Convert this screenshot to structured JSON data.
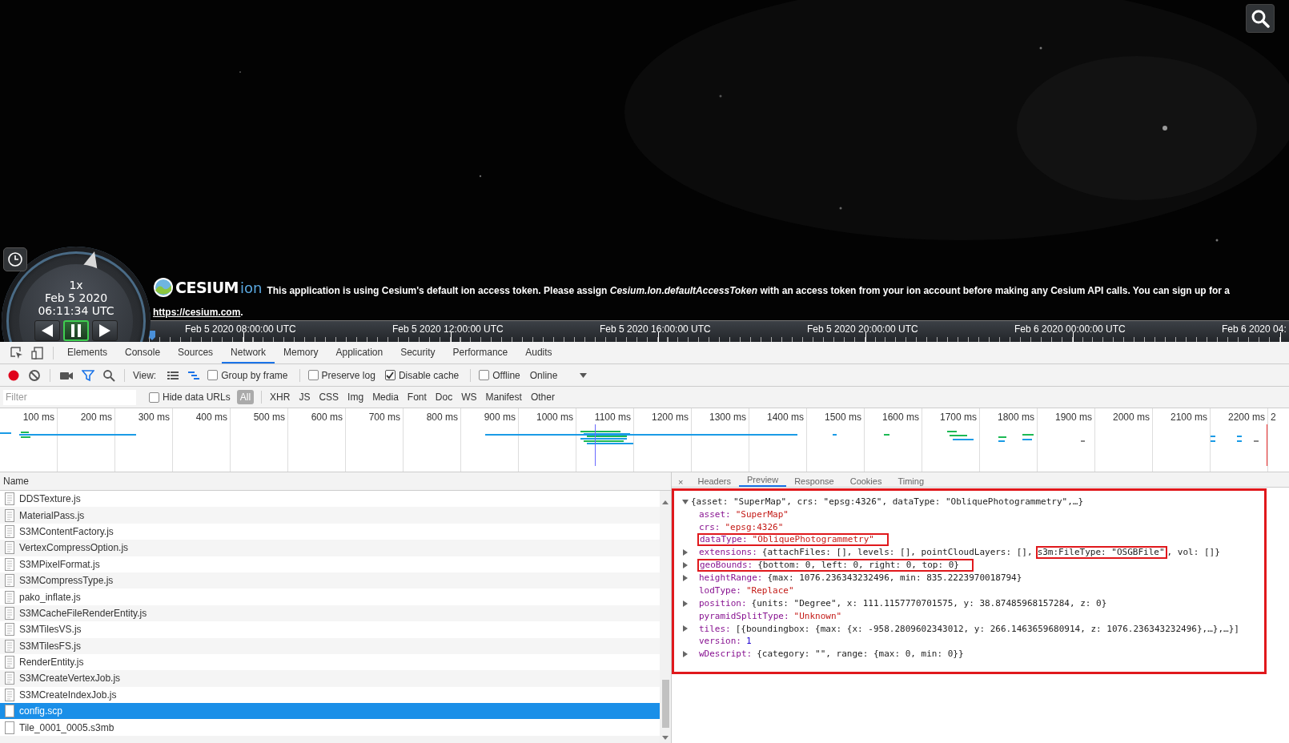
{
  "viewer": {
    "clock": {
      "speed": "1x",
      "date": "Feb 5 2020",
      "time": "06:11:34 UTC",
      "controls": [
        {
          "kind": "reverse",
          "selected": false
        },
        {
          "kind": "pause",
          "selected": true
        },
        {
          "kind": "play",
          "selected": false
        }
      ]
    },
    "banner": {
      "logo_word": "CESIUM",
      "logo_suffix": "ion",
      "message": "This application is using Cesium's default ion access token. Please assign *Cesium.Ion.defaultAccessToken* with an access token from your ion account before making any Cesium API calls. You can sign up for a",
      "link": "https://cesium.com",
      "link_suffix": "."
    },
    "timeline": {
      "labels": [
        "Feb 5 2020 08:00:00 UTC",
        "Feb 5 2020 12:00:00 UTC",
        "Feb 5 2020 16:00:00 UTC",
        "Feb 5 2020 20:00:00 UTC",
        "Feb 6 2020 00:00:00 UTC",
        "Feb 6 2020 04:"
      ]
    }
  },
  "devtools": {
    "panels": [
      {
        "label": "Elements",
        "selected": false
      },
      {
        "label": "Console",
        "selected": false
      },
      {
        "label": "Sources",
        "selected": false
      },
      {
        "label": "Network",
        "selected": true
      },
      {
        "label": "Memory",
        "selected": false
      },
      {
        "label": "Application",
        "selected": false
      },
      {
        "label": "Security",
        "selected": false
      },
      {
        "label": "Performance",
        "selected": false
      },
      {
        "label": "Audits",
        "selected": false
      }
    ],
    "toolbar": {
      "recording": true,
      "filter_active": true,
      "view_label": "View:",
      "views": [
        {
          "kind": "list",
          "selected": false
        },
        {
          "kind": "waterfall",
          "selected": true
        }
      ],
      "options": [
        {
          "label": "Group by frame",
          "checked": false
        },
        {
          "label": "Preserve log",
          "checked": false
        },
        {
          "label": "Disable cache",
          "checked": true
        },
        {
          "label": "Offline",
          "checked": false
        }
      ],
      "throttle": "Online"
    },
    "filter": {
      "placeholder": "Filter",
      "hide_data_urls": {
        "label": "Hide data URLs",
        "checked": false
      },
      "types": [
        {
          "label": "All",
          "selected": true
        },
        {
          "label": "XHR",
          "selected": false
        },
        {
          "label": "JS",
          "selected": false
        },
        {
          "label": "CSS",
          "selected": false
        },
        {
          "label": "Img",
          "selected": false
        },
        {
          "label": "Media",
          "selected": false
        },
        {
          "label": "Font",
          "selected": false
        },
        {
          "label": "Doc",
          "selected": false
        },
        {
          "label": "WS",
          "selected": false
        },
        {
          "label": "Manifest",
          "selected": false
        },
        {
          "label": "Other",
          "selected": false
        }
      ]
    },
    "overview": {
      "ticks": [
        "100 ms",
        "200 ms",
        "300 ms",
        "400 ms",
        "500 ms",
        "600 ms",
        "700 ms",
        "800 ms",
        "900 ms",
        "1000 ms",
        "1100 ms",
        "1200 ms",
        "1300 ms",
        "1400 ms",
        "1500 ms",
        "1600 ms",
        "1700 ms",
        "1800 ms",
        "1900 ms",
        "2000 ms",
        "2100 ms",
        "2200 ms",
        "2"
      ]
    },
    "requests": {
      "column": "Name",
      "rows": [
        {
          "name": "DDSTexture.js",
          "kind": "script",
          "selected": false
        },
        {
          "name": "MaterialPass.js",
          "kind": "script",
          "selected": false
        },
        {
          "name": "S3MContentFactory.js",
          "kind": "script",
          "selected": false
        },
        {
          "name": "VertexCompressOption.js",
          "kind": "script",
          "selected": false
        },
        {
          "name": "S3MPixelFormat.js",
          "kind": "script",
          "selected": false
        },
        {
          "name": "S3MCompressType.js",
          "kind": "script",
          "selected": false
        },
        {
          "name": "pako_inflate.js",
          "kind": "script",
          "selected": false
        },
        {
          "name": "S3MCacheFileRenderEntity.js",
          "kind": "script",
          "selected": false
        },
        {
          "name": "S3MTilesVS.js",
          "kind": "script",
          "selected": false
        },
        {
          "name": "S3MTilesFS.js",
          "kind": "script",
          "selected": false
        },
        {
          "name": "RenderEntity.js",
          "kind": "script",
          "selected": false
        },
        {
          "name": "S3MCreateVertexJob.js",
          "kind": "script",
          "selected": false
        },
        {
          "name": "S3MCreateIndexJob.js",
          "kind": "script",
          "selected": false
        },
        {
          "name": "config.scp",
          "kind": "document",
          "selected": true
        },
        {
          "name": "Tile_0001_0005.s3mb",
          "kind": "document",
          "selected": false
        }
      ]
    },
    "details": {
      "close": "×",
      "tabs": [
        {
          "label": "Headers",
          "selected": false
        },
        {
          "label": "Preview",
          "selected": true
        },
        {
          "label": "Response",
          "selected": false
        },
        {
          "label": "Cookies",
          "selected": false
        },
        {
          "label": "Timing",
          "selected": false
        }
      ],
      "preview": {
        "framed": true,
        "expanded": true,
        "summary": "{asset: \"SuperMap\", crs: \"epsg:4326\", dataType: \"ObliquePhotogrammetry\",…}",
        "properties": [
          {
            "key": "asset:",
            "value": "\"SuperMap\"",
            "kind": "string",
            "expandable": false,
            "highlighted": false
          },
          {
            "key": "crs:",
            "value": "\"epsg:4326\"",
            "kind": "string",
            "expandable": false,
            "highlighted": false
          },
          {
            "key": "dataType:",
            "value": "\"ObliquePhotogrammetry\"",
            "kind": "string",
            "expandable": false,
            "highlighted": true
          },
          {
            "key": "extensions:",
            "value": "{attachFiles: [], levels: [], pointCloudLayers: [],",
            "highlight": "s3m:FileType: \"OSGBFile\"",
            "value_end": ", vol: []}",
            "kind": "object",
            "expandable": true,
            "highlighted": false
          },
          {
            "key": "geoBounds:",
            "value": "{bottom: 0, left: 0, right: 0, top: 0}",
            "kind": "object",
            "expandable": true,
            "highlighted": true
          },
          {
            "key": "heightRange:",
            "value": "{max: 1076.236343232496, min: 835.2223970018794}",
            "kind": "object",
            "expandable": true,
            "highlighted": false
          },
          {
            "key": "lodType:",
            "value": "\"Replace\"",
            "kind": "string",
            "expandable": false,
            "highlighted": false
          },
          {
            "key": "position:",
            "value": "{units: \"Degree\", x: 111.1157770701575, y: 38.87485968157284, z: 0}",
            "kind": "object",
            "expandable": true,
            "highlighted": false
          },
          {
            "key": "pyramidSplitType:",
            "value": "\"Unknown\"",
            "kind": "string",
            "expandable": false,
            "highlighted": false
          },
          {
            "key": "tiles:",
            "value": "[{boundingbox: {max: {x: -958.2809602343012, y: 266.1463659680914, z: 1076.236343232496},…},…}]",
            "kind": "object",
            "expandable": true,
            "highlighted": false
          },
          {
            "key": "version:",
            "value": "1",
            "kind": "number",
            "expandable": false,
            "highlighted": false
          },
          {
            "key": "wDescript:",
            "value": "{category: \"\", range: {max: 0, min: 0}}",
            "kind": "object",
            "expandable": true,
            "highlighted": false
          }
        ]
      }
    }
  }
}
